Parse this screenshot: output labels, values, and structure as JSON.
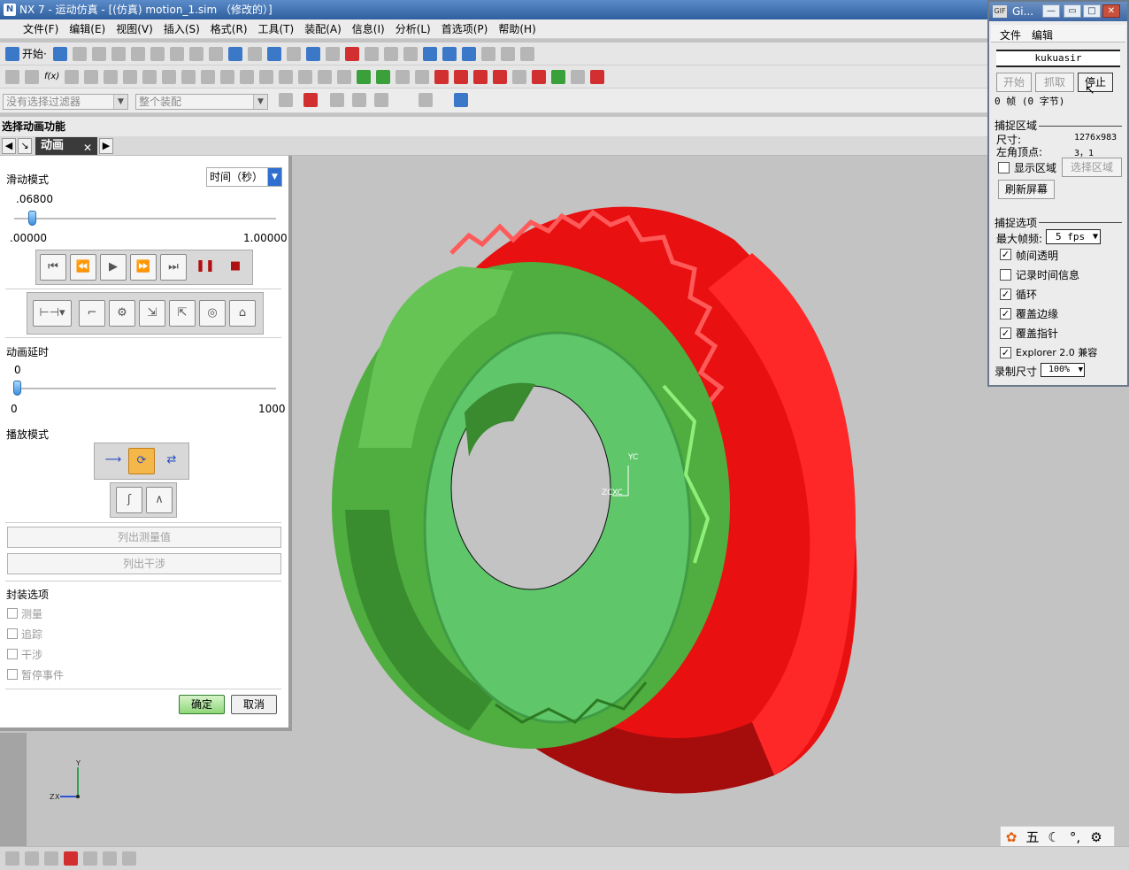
{
  "window": {
    "title": "NX 7 - 运动仿真 - [(仿真) motion_1.sim （修改的）]"
  },
  "menu": [
    "文件(F)",
    "编辑(E)",
    "视图(V)",
    "插入(S)",
    "格式(R)",
    "工具(T)",
    "装配(A)",
    "信息(I)",
    "分析(L)",
    "首选项(P)",
    "帮助(H)"
  ],
  "toolbar": {
    "start_label": "开始·",
    "fx_label": "f(x)"
  },
  "filters": {
    "selection_filter": "没有选择过滤器",
    "assembly_scope": "整个装配"
  },
  "section_title": "选择动画功能",
  "tab": {
    "label": "动画"
  },
  "dialog": {
    "slider_mode_label": "滑动模式",
    "time_mode_value": "时间（秒）",
    "time_value": ".06800",
    "time_min": ".00000",
    "time_max": "1.00000",
    "time_fraction": 0.068,
    "delay_label": "动画延时",
    "delay_value": "0",
    "delay_min": "0",
    "delay_max": "1000",
    "playback_label": "播放模式",
    "list_measure": "列出测量值",
    "list_interference": "列出干涉",
    "envelope_label": "封装选项",
    "opt_measure": "测量",
    "opt_trace": "追踪",
    "opt_interference": "干涉",
    "opt_pause": "暂停事件",
    "ok": "确定",
    "cancel": "取消"
  },
  "gif_tool": {
    "title": "Gi...",
    "menu_file": "文件",
    "menu_edit": "编辑",
    "name": "kukuasir",
    "btn_start": "开始",
    "btn_capture": "抓取",
    "btn_stop": "停止",
    "frames": "0 帧 (0 字节)",
    "capture_area": "捕捉区域",
    "size_label": "尺寸:",
    "size_value": "1276x983",
    "origin_label": "左角顶点:",
    "origin_value": "3，1",
    "show_area": "显示区域",
    "select_area": "选择区域",
    "refresh": "刷新屏幕",
    "capture_options": "捕捉选项",
    "max_fps_label": "最大帧频:",
    "max_fps_value": "5 fps",
    "opt_transparent": "帧间透明",
    "opt_timeinfo": "记录时间信息",
    "opt_loop": "循环",
    "opt_cover_edge": "覆盖边缘",
    "opt_cover_cursor": "覆盖指针",
    "opt_explorer": "Explorer 2.0 兼容",
    "rec_size_label": "录制尺寸",
    "rec_size_value": "100%"
  },
  "axes": {
    "yc": "YC",
    "zc": "ZC",
    "xc": "XC",
    "y": "Y",
    "z": "Z",
    "x": "X"
  },
  "tray": [
    "五",
    "☾",
    "°,",
    "⚙"
  ],
  "colors": {
    "gear_red": "#ff1a1a",
    "gear_green": "#5ccc5c",
    "accent": "#3e68a6"
  }
}
